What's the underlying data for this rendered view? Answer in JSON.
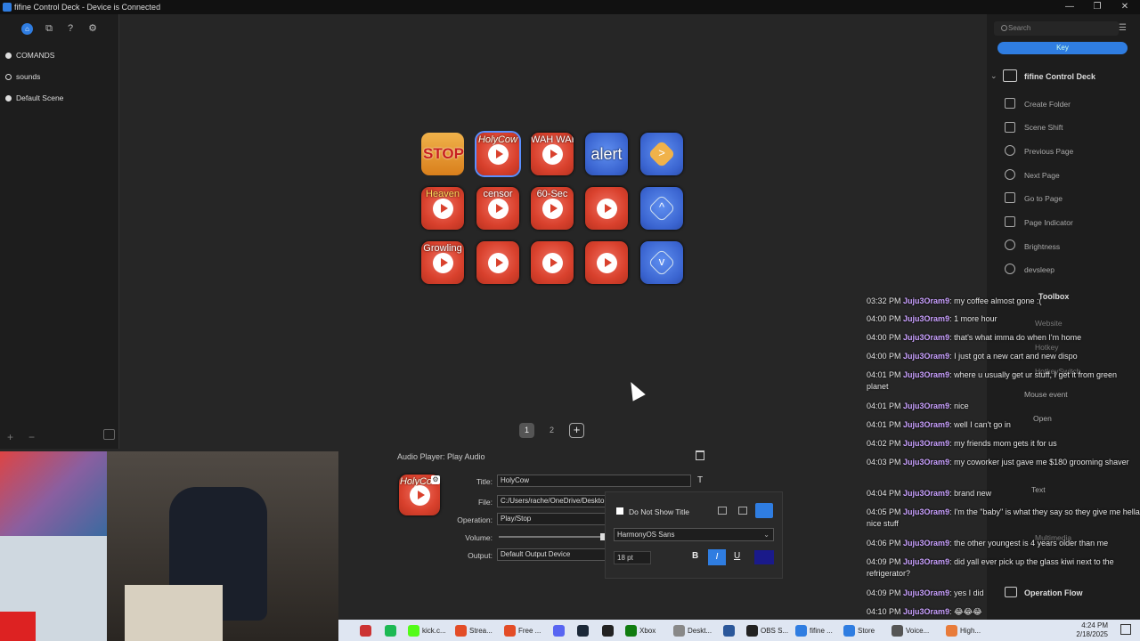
{
  "window": {
    "title": "fifine Control Deck - Device is Connected",
    "min": "—",
    "max": "❐",
    "close": "✕"
  },
  "toolbar": {
    "icons": [
      "app-icon",
      "copy-icon",
      "help-icon",
      "settings-icon"
    ],
    "help_glyph": "?",
    "copy_glyph": "⧉",
    "gear_glyph": "⚙"
  },
  "scenes": [
    {
      "label": "COMANDS",
      "selected": true
    },
    {
      "label": "sounds",
      "selected": false
    },
    {
      "label": "Default Scene",
      "selected": true
    }
  ],
  "left_bottom": {
    "add": "+",
    "remove": "−"
  },
  "keys": {
    "row1": [
      {
        "type": "stop",
        "label": "STOP"
      },
      {
        "type": "play",
        "label": "HolyCow"
      },
      {
        "type": "play",
        "label": "WAH WAH"
      },
      {
        "type": "alert",
        "label": "alert"
      },
      {
        "type": "nav",
        "glyph": ">"
      }
    ],
    "row2": [
      {
        "type": "play",
        "label": "Heaven"
      },
      {
        "type": "play",
        "label": "censor"
      },
      {
        "type": "play",
        "label": "60-Sec"
      },
      {
        "type": "play",
        "label": ""
      },
      {
        "type": "nav",
        "glyph": "^"
      }
    ],
    "row3": [
      {
        "type": "play",
        "label": "Growling"
      },
      {
        "type": "play",
        "label": ""
      },
      {
        "type": "play",
        "label": ""
      },
      {
        "type": "play",
        "label": ""
      },
      {
        "type": "nav",
        "glyph": "v"
      }
    ]
  },
  "pages": {
    "p1": "1",
    "p2": "2",
    "add": "+"
  },
  "props": {
    "header": "Audio Player: Play Audio",
    "title_label": "Title:",
    "title_value": "HolyCow",
    "file_label": "File:",
    "file_value": "C:/Users/rache/OneDrive/Deskto",
    "operation_label": "Operation:",
    "operation_value": "Play/Stop",
    "volume_label": "Volume:",
    "output_label": "Output:",
    "output_value": "Default Output Device",
    "thumb_label": "HolyCow"
  },
  "popup": {
    "hide_title_label": "Do Not Show Title",
    "font": "HarmonyOS Sans",
    "size": "18 pt",
    "bold": "B",
    "italic": "I",
    "underline": "U",
    "color": "#1a1a8a"
  },
  "right_panel": {
    "search_placeholder": "Search",
    "key_label": "Key",
    "section1": "fifine Control Deck",
    "items1": [
      "Create Folder",
      "Scene Shift",
      "Previous Page",
      "Next Page",
      "Go to Page",
      "Page Indicator",
      "Brightness",
      "devsleep"
    ],
    "section2": "Toolbox",
    "items2": [
      "Website",
      "Hotkey",
      "HotkeySwitch",
      "Mouse event",
      "Open",
      "Text",
      "Multimedia"
    ],
    "section3": "Operation Flow"
  },
  "chat": [
    {
      "time": "03:32 PM",
      "user": "Juju3Oram9",
      "text": ": my coffee almost gone :("
    },
    {
      "time": "04:00 PM",
      "user": "Juju3Oram9",
      "text": ": 1 more hour"
    },
    {
      "time": "04:00 PM",
      "user": "Juju3Oram9",
      "text": ": that's what imma do when I'm home"
    },
    {
      "time": "04:00 PM",
      "user": "Juju3Oram9",
      "text": ": I just got a new cart and new dispo"
    },
    {
      "time": "04:01 PM",
      "user": "Juju3Oram9",
      "text": ": where u usually get ur stuff, I get it from green planet"
    },
    {
      "time": "04:01 PM",
      "user": "Juju3Oram9",
      "text": ": nice"
    },
    {
      "time": "04:01 PM",
      "user": "Juju3Oram9",
      "text": ": well I can't go in"
    },
    {
      "time": "04:02 PM",
      "user": "Juju3Oram9",
      "text": ": my friends mom gets it for us"
    },
    {
      "time": "04:03 PM",
      "user": "Juju3Oram9",
      "text": ": my coworker just gave me $180 grooming shaver"
    },
    {
      "time": "04:04 PM",
      "user": "Juju3Oram9",
      "text": ": brand new"
    },
    {
      "time": "04:05 PM",
      "user": "Juju3Oram9",
      "text": ": I'm the \"baby\" is what they say so they give me hella nice stuff"
    },
    {
      "time": "04:06 PM",
      "user": "Juju3Oram9",
      "text": ": the other youngest is 4 years older than me"
    },
    {
      "time": "04:09 PM",
      "user": "Juju3Oram9",
      "text": ": did yall ever pick up the glass kiwi next to the refrigerator?"
    },
    {
      "time": "04:09 PM",
      "user": "Juju3Oram9",
      "text": ": yes I did"
    },
    {
      "time": "04:10 PM",
      "user": "Juju3Oram9",
      "text": ": 😂😂😂"
    }
  ],
  "taskbar": {
    "items": [
      {
        "label": "",
        "color": "#c33"
      },
      {
        "label": "",
        "color": "#1db954"
      },
      {
        "label": "kick.c...",
        "color": "#53fc18"
      },
      {
        "label": "Strea...",
        "color": "#e34c26"
      },
      {
        "label": "Free ...",
        "color": "#e34c26"
      },
      {
        "label": "",
        "color": "#5865f2"
      },
      {
        "label": "",
        "color": "#1b2838"
      },
      {
        "label": "",
        "color": "#222"
      },
      {
        "label": "Xbox",
        "color": "#107c10"
      },
      {
        "label": "Deskt...",
        "color": "#888"
      },
      {
        "label": "",
        "color": "#2b579a"
      },
      {
        "label": "OBS S...",
        "color": "#222"
      },
      {
        "label": "fifine ...",
        "color": "#2f7de1"
      },
      {
        "label": "Store",
        "color": "#2f7de1"
      },
      {
        "label": "Voice...",
        "color": "#555"
      },
      {
        "label": "High...",
        "color": "#e87b3a"
      }
    ],
    "time": "4:24 PM",
    "date": "2/18/2025"
  }
}
